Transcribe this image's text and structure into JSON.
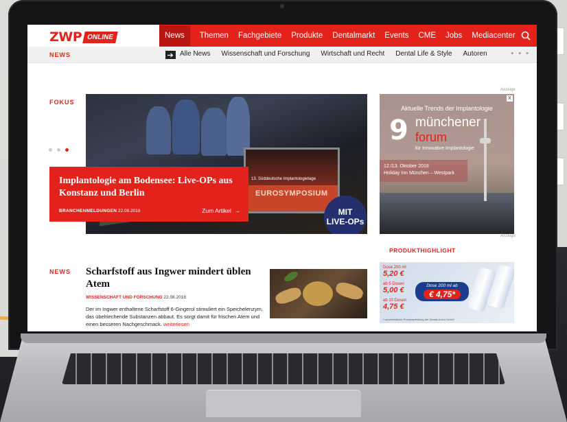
{
  "site": {
    "logo_main": "ZWP",
    "logo_badge": "ONLINE",
    "accent": "#e3231b"
  },
  "nav": {
    "items": [
      "News",
      "Themen",
      "Fachgebiete",
      "Produkte",
      "Dentalmarkt",
      "Events",
      "CME",
      "Jobs",
      "Mediacenter"
    ],
    "active": "News",
    "search_icon": "search-icon"
  },
  "subnav": {
    "section": "NEWS",
    "items": [
      "Alle News",
      "Wissenschaft und Forschung",
      "Wirtschaft und Recht",
      "Dental Life & Style",
      "Autoren"
    ],
    "more": "• • •"
  },
  "focus": {
    "label": "FOKUS",
    "slides": 3,
    "active_slide": 3,
    "title": "Implantologie am Bodensee: Live-OPs aus Konstanz und Berlin",
    "category": "BRANCHENMELDUNGEN",
    "date": "22.08.2018",
    "link": "Zum Artikel",
    "image": {
      "sign_line1": "13. Süddeutsche Implantologietage",
      "sign_line2": "EUROSYMPOSIUM",
      "badge_line1": "MIT",
      "badge_line2": "LIVE-OPs"
    }
  },
  "ad_top": {
    "anzeige": "Anzeige",
    "close": "X",
    "headline": "Aktuelle Trends der Implantologie",
    "number": "9",
    "name_line1": "münchener",
    "name_line2": "forum",
    "subtitle": "für Innovative Implantologie",
    "date": "12./13. Oktober 2018",
    "venue": "Holiday Inn München – Westpark"
  },
  "news": {
    "label": "NEWS",
    "title": "Scharfstoff aus Ingwer mindert üblen Atem",
    "category": "WISSENSCHAFT UND FORSCHUNG",
    "date": "22.08.2018",
    "text": "Der im Ingwer enthaltene Scharfstoff 6-Gingerol stimuliert ein Speichelenzym, das übelriechende Substanzen abbaut. Es sorgt damit für frischen Atem und einen besseren Nachgeschmack.",
    "more": "weiterlesen"
  },
  "ad_bottom": {
    "anzeige": "Anzeige",
    "header": "PRODUKTHIGHLIGHT",
    "prices": [
      {
        "label": "Dose 200 ml",
        "value": "5,20 €"
      },
      {
        "label": "ab 5 Dosen",
        "value": "5,00 €"
      },
      {
        "label": "ab 10 Dosen",
        "value": "4,75 €"
      }
    ],
    "badge_label": "Dose 200 ml ab",
    "badge_price": "€ 4,75*",
    "note": "* unverbindliche Preisempfehlung der Dental-Union GmbH"
  }
}
